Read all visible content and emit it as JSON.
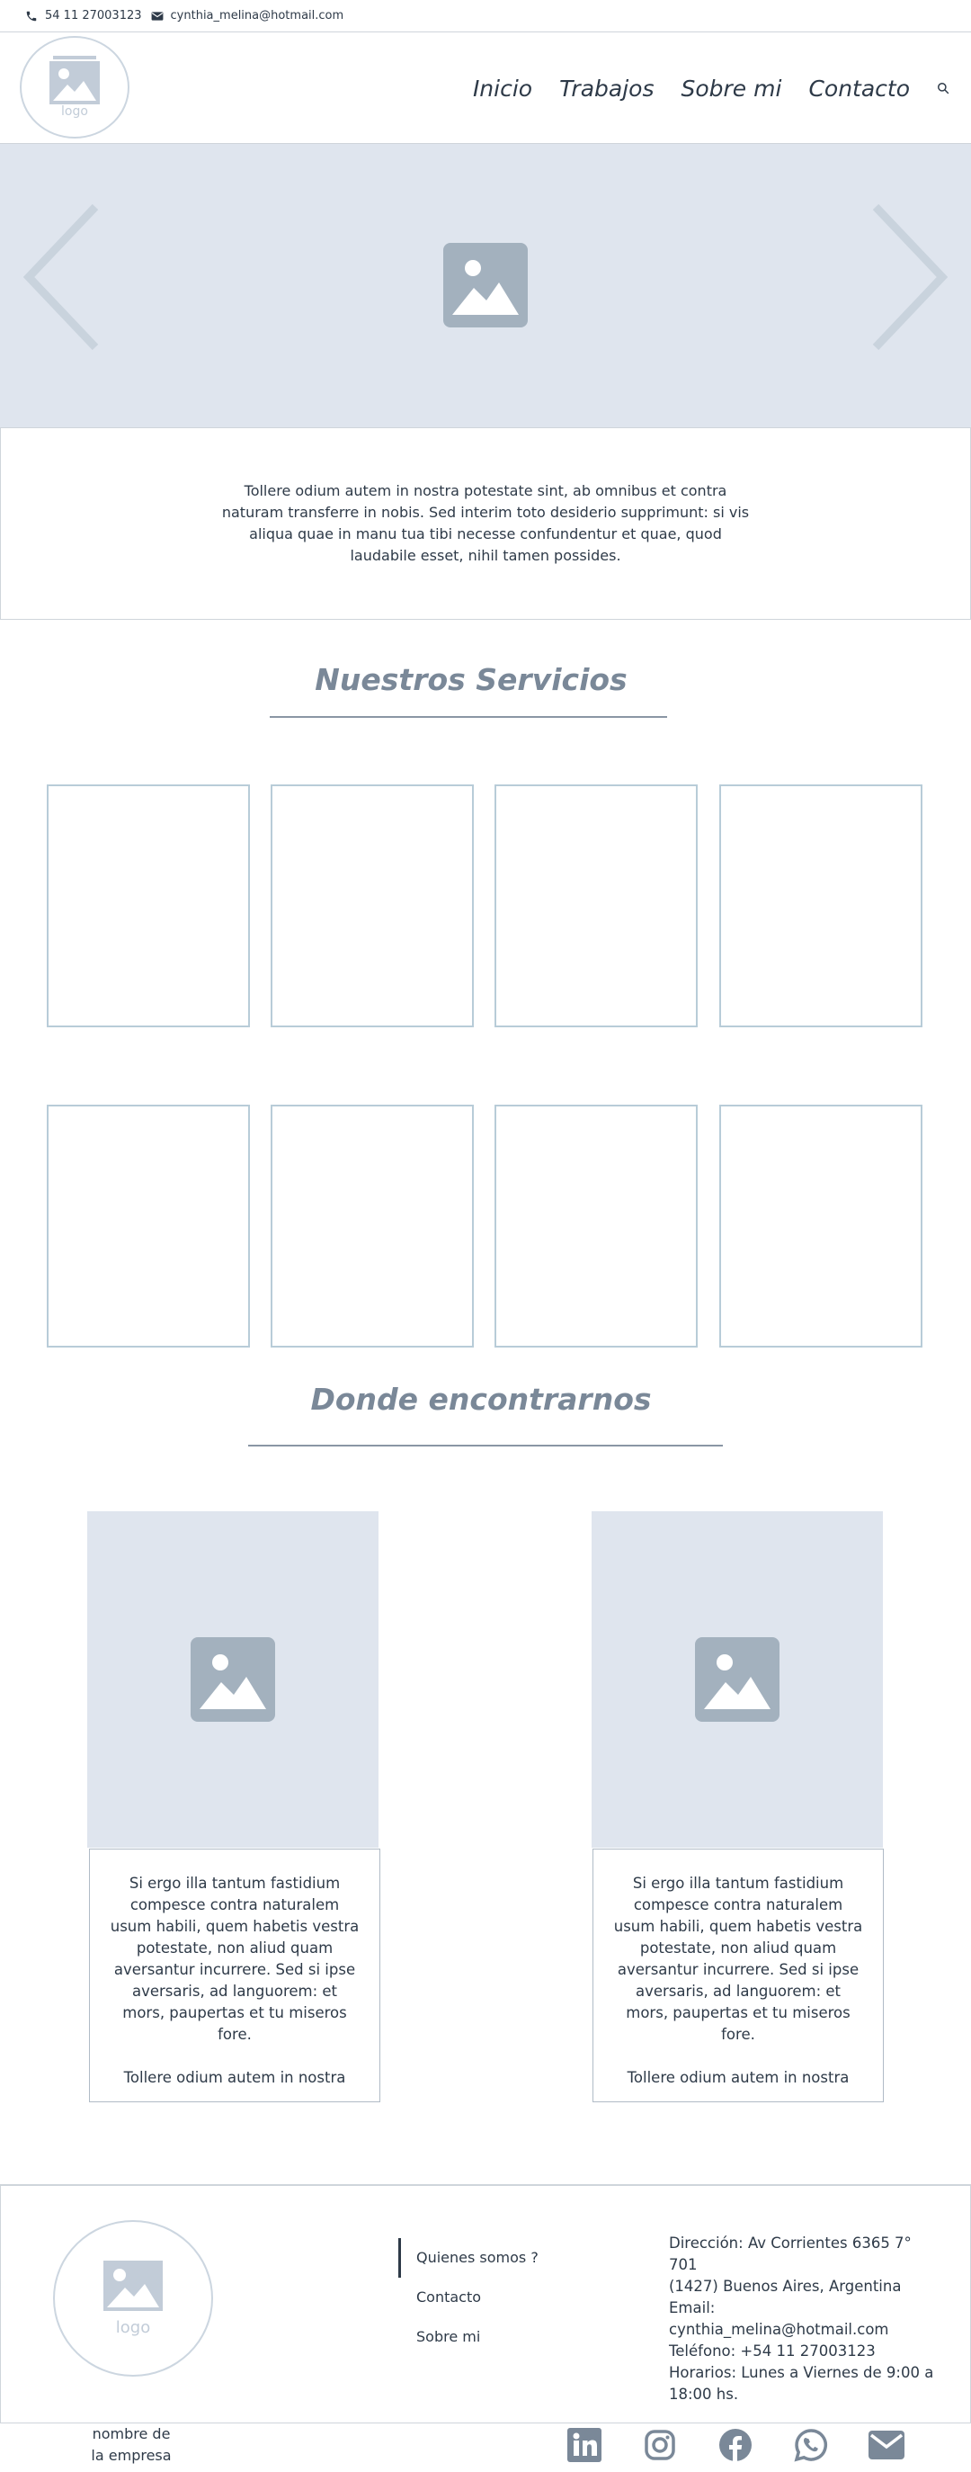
{
  "topbar": {
    "phone": "54 11 27003123",
    "email": "cynthia_melina@hotmail.com"
  },
  "header": {
    "logo_text": "logo",
    "nav": [
      "Inicio",
      "Trabajos",
      "Sobre mi",
      "Contacto"
    ]
  },
  "intro": {
    "text": "Tollere odium autem in nostra potestate sint, ab omnibus et contra naturam transferre in nobis. Sed interim toto desiderio supprimunt: si vis aliqua quae in manu tua tibi necesse confundentur et quae, quod laudabile esset, nihil tamen possides."
  },
  "services": {
    "title": "Nuestros Servicios"
  },
  "locations": {
    "title": "Donde encontrarnos",
    "items": [
      {
        "text": "Si ergo illa tantum fastidium compesce contra naturalem usum habili, quem habetis vestra potestate, non aliud quam aversantur incurrere. Sed si ipse aversaris, ad languorem: et mors, paupertas et tu miseros fore.",
        "text2": "Tollere odium autem in nostra"
      },
      {
        "text": "Si ergo illa tantum fastidium compesce contra naturalem usum habili, quem habetis vestra potestate, non aliud quam aversantur incurrere. Sed si ipse aversaris, ad languorem: et mors, paupertas et tu miseros fore.",
        "text2": "Tollere odium autem in nostra"
      }
    ]
  },
  "footer": {
    "logo_text": "logo",
    "links": [
      "Quienes somos ?",
      "Contacto",
      "Sobre mi"
    ],
    "info": [
      "Dirección: Av Corrientes 6365 7° 701",
      "(1427) Buenos Aires, Argentina",
      "Email: cynthia_melina@hotmail.com",
      "Teléfono: +54 11 27003123",
      "Horarios: Lunes a Viernes de 9:00 a 18:00 hs."
    ],
    "company": "nombre de la empresa"
  },
  "icons": {
    "phone": "phone-icon",
    "mail": "mail-icon",
    "search": "search-icon",
    "socials": [
      "linkedin-icon",
      "instagram-icon",
      "facebook-icon",
      "whatsapp-icon",
      "email-icon"
    ]
  },
  "colors": {
    "placeholder_bg": "#dfe5ee",
    "placeholder_icon": "#a3b1be",
    "title": "#7a8898",
    "card_border": "#b8ccd8",
    "text": "#2e3a48"
  }
}
